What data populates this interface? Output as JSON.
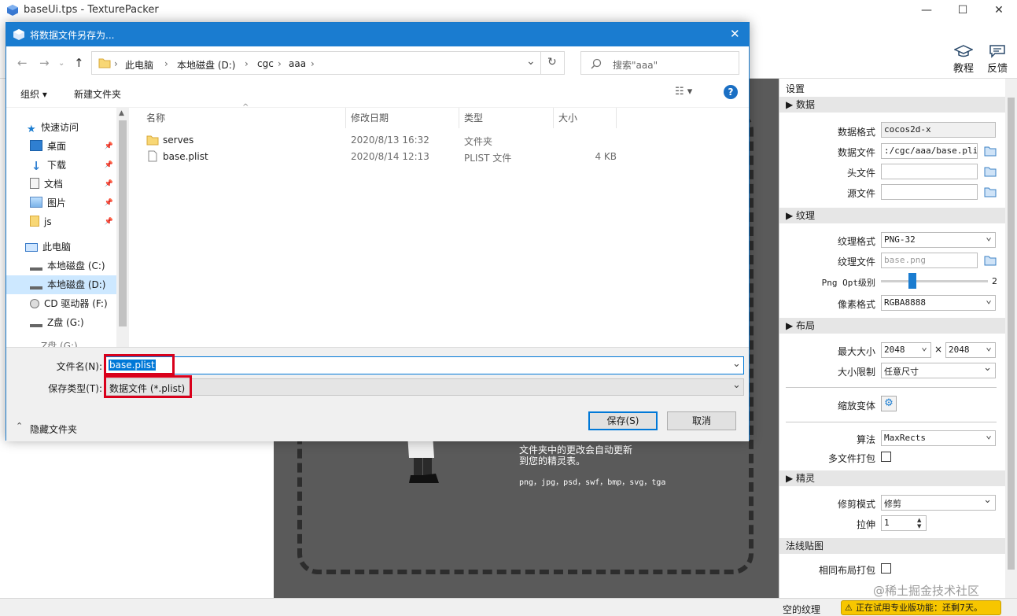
{
  "main": {
    "title": "baseUi.tps - TexturePacker",
    "toolbar": {
      "tutorial_label": "教程",
      "feedback_label": "反馈"
    },
    "canvas": {
      "hint_lines": [
        "文件夹中的更改会自动更新",
        "到您的精灵表。"
      ],
      "formats": "png，jpg，psd，swf，bmp，svg，tga"
    },
    "settings": {
      "header": "设置",
      "data_section": "▶ 数据",
      "data_format_label": "数据格式",
      "data_format_value": "cocos2d-x",
      "data_file_label": "数据文件",
      "data_file_value": ":/cgc/aaa/base.plist",
      "header_file_label": "头文件",
      "source_file_label": "源文件",
      "texture_section": "▶ 纹理",
      "texture_format_label": "纹理格式",
      "texture_format_value": "PNG-32",
      "texture_file_label": "纹理文件",
      "texture_file_placeholder": "base.png",
      "png_opt_label": "Png Opt级别",
      "png_opt_value": "2",
      "pixel_format_label": "像素格式",
      "pixel_format_value": "RGBA8888",
      "layout_section": "▶ 布局",
      "max_size_label": "最大大小",
      "max_w": "2048",
      "times": "×",
      "max_h": "2048",
      "size_limit_label": "大小限制",
      "size_limit_value": "任意尺寸",
      "scale_variant_label": "缩放变体",
      "algorithm_label": "算法",
      "algorithm_value": "MaxRects",
      "multipack_label": "多文件打包",
      "sprite_section": "▶ 精灵",
      "trim_mode_label": "修剪模式",
      "trim_mode_value": "修剪",
      "extrude_label": "拉伸",
      "extrude_value": "1",
      "normal_section": "法线贴图",
      "same_layout_label": "相同布局打包"
    },
    "statusbar": {
      "empty_texture": "空的纹理",
      "trial_badge": "正在试用专业版功能：还剩7天。",
      "watermark": "@稀土掘金技术社区"
    }
  },
  "dialog": {
    "title": "将数据文件另存为...",
    "breadcrumbs": [
      "此电脑",
      "本地磁盘 (D:)",
      "cgc",
      "aaa"
    ],
    "crumb_sep": "›",
    "search_placeholder": "搜索\"aaa\"",
    "organize_label": "组织",
    "new_folder_label": "新建文件夹",
    "nav": {
      "quick_access": "快速访问",
      "desktop": "桌面",
      "downloads": "下载",
      "documents": "文档",
      "pictures": "图片",
      "js": "js",
      "this_pc": "此电脑",
      "drive_c": "本地磁盘 (C:)",
      "drive_d": "本地磁盘 (D:)",
      "drive_f": "CD 驱动器 (F:)",
      "drive_g": "Z盘 (G:)",
      "drive_g_cut": "Z盘 (G:)"
    },
    "columns": {
      "name": "名称",
      "date": "修改日期",
      "type": "类型",
      "size": "大小"
    },
    "files": [
      {
        "name": "serves",
        "date": "2020/8/13 16:32",
        "type": "文件夹",
        "size": ""
      },
      {
        "name": "base.plist",
        "date": "2020/8/14 12:13",
        "type": "PLIST 文件",
        "size": "4 KB"
      }
    ],
    "filename_label": "文件名(N):",
    "filename_value": "base.plist",
    "filetype_label": "保存类型(T):",
    "filetype_value": "数据文件 (*.plist)",
    "hide_folders_label": "隐藏文件夹",
    "save_label": "保存(S)",
    "cancel_label": "取消"
  }
}
